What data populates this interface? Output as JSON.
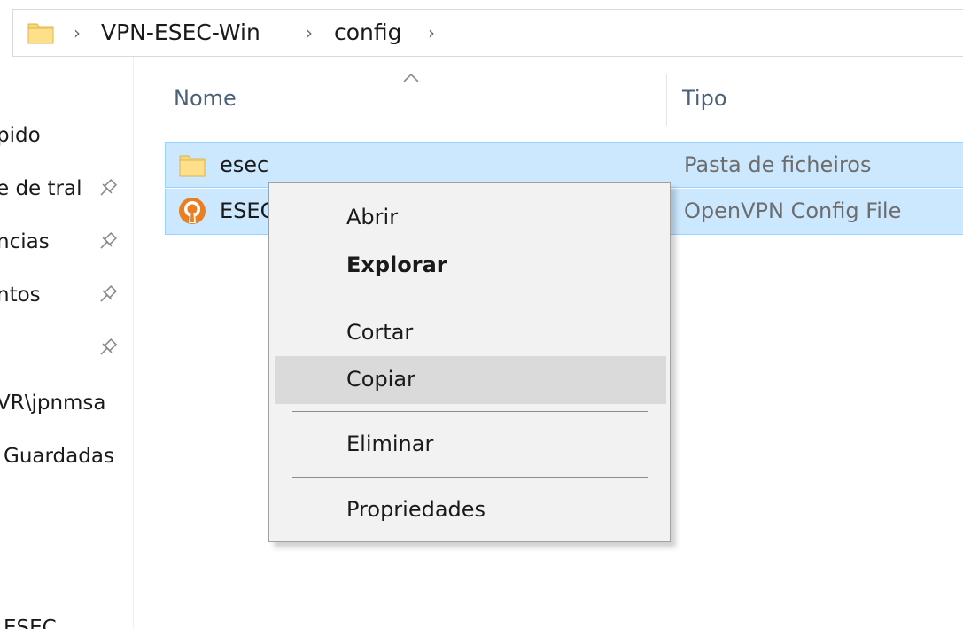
{
  "address_bar": {
    "segments": [
      "VPN-ESEC-Win",
      "config"
    ],
    "separator": "›",
    "folder_icon": "folder-icon"
  },
  "nav_pane": {
    "items": [
      {
        "label": "Acesso rápido",
        "visible_text": "pido",
        "pinned": false
      },
      {
        "label": "Ambiente de trabalho",
        "visible_text": "e de tral",
        "pinned": true
      },
      {
        "label": "Transferências",
        "visible_text": "ncias",
        "pinned": true
      },
      {
        "label": "Documentos",
        "visible_text": "ntos",
        "pinned": true
      },
      {
        "label": "",
        "visible_text": "",
        "pinned": true
      },
      {
        "label": "\\\\VR\\jpnmsa",
        "visible_text": "VR\\jpnmsa",
        "pinned": false
      },
      {
        "label": "Guardadas",
        "visible_text": "Guardadas",
        "pinned": false
      },
      {
        "label": "ESEC",
        "visible_text": "ESEC",
        "pinned": false
      }
    ]
  },
  "columns": {
    "name": "Nome",
    "type": "Tipo",
    "sort_icon": "sort-ascending-icon"
  },
  "files": [
    {
      "name": "esec",
      "type": "Pasta de ficheiros",
      "icon": "folder-icon",
      "selected": true
    },
    {
      "name": "ESEC",
      "type": "OpenVPN Config File",
      "icon": "openvpn-icon",
      "selected": true
    }
  ],
  "context_menu": {
    "items": [
      {
        "label": "Abrir",
        "bold": false,
        "hover": false
      },
      {
        "label": "Explorar",
        "bold": true,
        "hover": false
      },
      {
        "label": "Cortar",
        "bold": false,
        "hover": false
      },
      {
        "label": "Copiar",
        "bold": false,
        "hover": true
      },
      {
        "label": "Eliminar",
        "bold": false,
        "hover": false
      },
      {
        "label": "Propriedades",
        "bold": false,
        "hover": false
      }
    ]
  },
  "colors": {
    "selection_bg": "#cce8ff",
    "selection_border": "#99d1ff",
    "menu_bg": "#f2f2f2",
    "menu_hover": "#dadada",
    "header_text": "#4c607a",
    "folder_yellow": "#ffd966",
    "openvpn_orange": "#ea7e20"
  }
}
